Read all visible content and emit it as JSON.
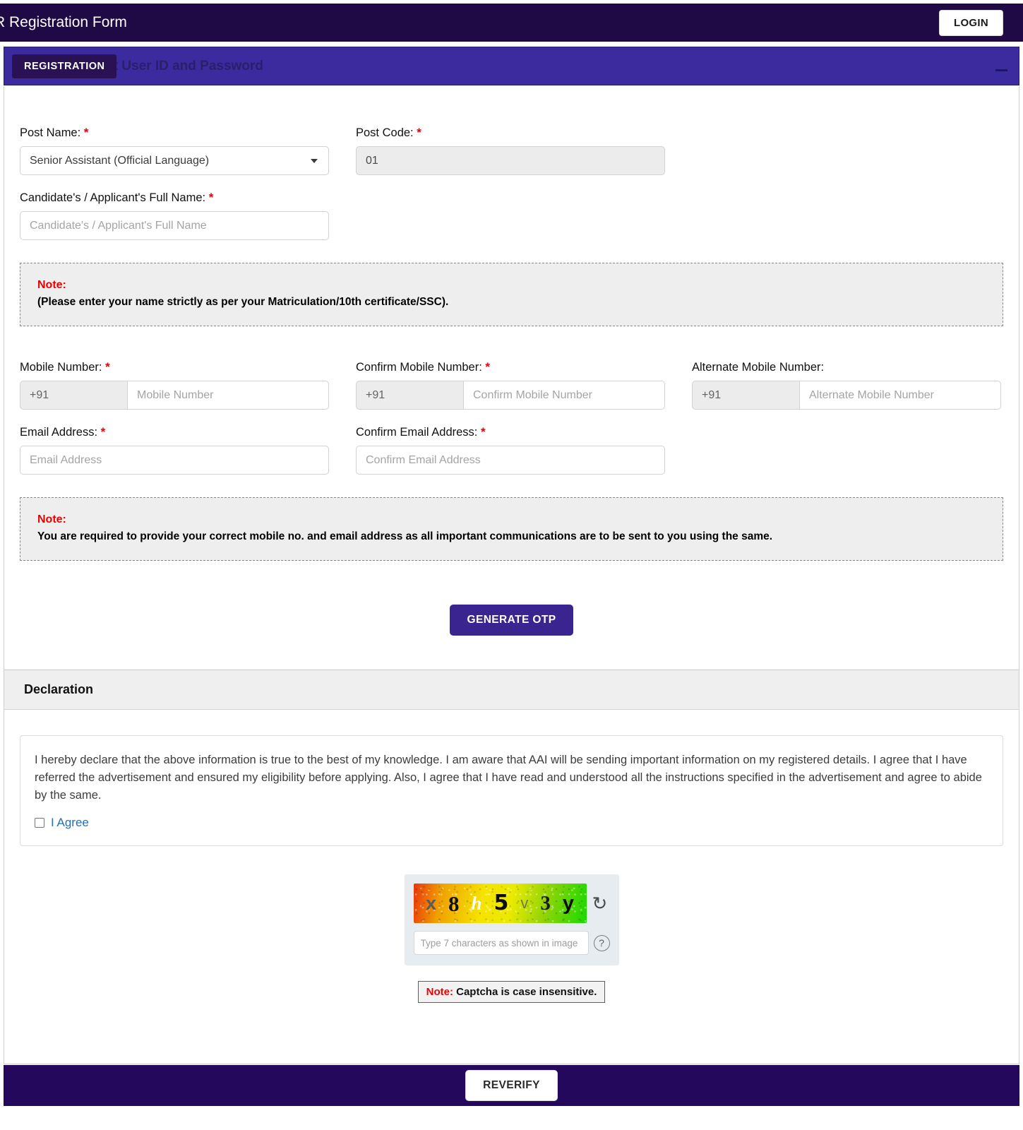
{
  "header": {
    "title": "'R Registration Form",
    "login_label": "LOGIN"
  },
  "subheader": {
    "tag_label": "REGISTRATION",
    "title": "Register to get User ID and Password",
    "collapse_icon": "minimize-icon"
  },
  "form": {
    "post_name": {
      "label": "Post Name:",
      "required": "*",
      "value": "Senior Assistant (Official Language)",
      "caret_icon": "chevron-down-icon"
    },
    "post_code": {
      "label": "Post Code:",
      "required": "*",
      "value": "01"
    },
    "full_name": {
      "label": "Candidate's / Applicant's Full Name:",
      "required": "*",
      "placeholder": "Candidate's / Applicant's Full Name",
      "value": ""
    },
    "note_name": {
      "label": "Note:",
      "text": "(Please enter your name strictly as per your Matriculation/10th certificate/SSC)."
    },
    "mobile": {
      "label": "Mobile Number:",
      "required": "*",
      "country_code": "+91",
      "placeholder": "Mobile Number",
      "value": ""
    },
    "confirm_mobile": {
      "label": "Confirm Mobile Number:",
      "required": "*",
      "country_code": "+91",
      "placeholder": "Confirm Mobile Number",
      "value": ""
    },
    "alternate_mobile": {
      "label": "Alternate Mobile Number:",
      "required": "",
      "country_code": "+91",
      "placeholder": "Alternate Mobile Number",
      "value": ""
    },
    "email": {
      "label": "Email Address:",
      "required": "*",
      "placeholder": "Email Address",
      "value": ""
    },
    "confirm_email": {
      "label": "Confirm Email Address:",
      "required": "*",
      "placeholder": "Confirm Email Address",
      "value": ""
    },
    "note_contact": {
      "label": "Note:",
      "text": "You are required to provide your correct mobile no. and email address as all important communications are to be sent to you using the same."
    },
    "generate_otp_label": "GENERATE OTP"
  },
  "declaration": {
    "heading": "Declaration",
    "text": "I hereby declare that the above information is true to the best of my knowledge. I am aware that AAI will be sending important information on my registered details. I agree that I have referred the advertisement and ensured my eligibility before applying. Also, I agree that I have read and understood all the instructions specified in the advertisement and agree to abide by the same.",
    "agree_label": "I Agree",
    "agree_checked": false
  },
  "captcha": {
    "characters": [
      "x",
      "8",
      "h",
      "5",
      "v",
      "3",
      "y"
    ],
    "code": "x8h5v3y",
    "refresh_icon": "refresh-icon",
    "help_icon": "question-mark-icon",
    "input_placeholder": "Type 7 characters as shown in image",
    "input_value": "",
    "note_label": "Note:",
    "note_text": "Captcha is case insensitive."
  },
  "footer": {
    "reverify_label": "REVERIFY"
  },
  "colors": {
    "header_bg": "#1f0a46",
    "subheader_bg": "#3b2b9e",
    "tag_bg": "#2a1154",
    "accent_button": "#3a2490",
    "footer_bg": "#24085c",
    "required_red": "#e8000d",
    "note_red": "#ee0000",
    "link_blue": "#1b72b8"
  }
}
